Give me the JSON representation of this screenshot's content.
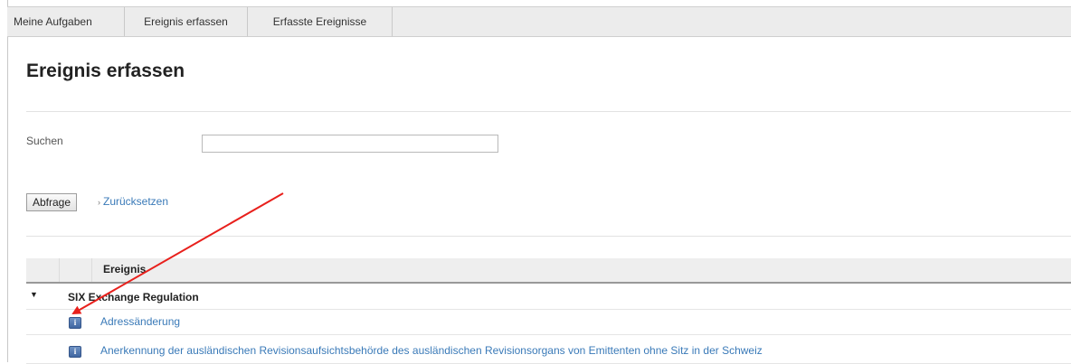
{
  "tabs": [
    {
      "label": "Meine Aufgaben"
    },
    {
      "label": "Ereignis erfassen"
    },
    {
      "label": "Erfasste Ereignisse"
    }
  ],
  "page": {
    "title": "Ereignis erfassen"
  },
  "search": {
    "label": "Suchen",
    "value": ""
  },
  "actions": {
    "query_label": "Abfrage",
    "reset_label": "Zurücksetzen"
  },
  "table": {
    "header": {
      "event": "Ereignis"
    },
    "group": {
      "label": "SIX Exchange Regulation",
      "toggle": "▼"
    },
    "items": [
      {
        "label": "Adressänderung",
        "icon": "info-icon"
      },
      {
        "label": "Anerkennung der ausländischen Revisionsaufsichtsbehörde des ausländischen Revisionsorgans von Emittenten ohne Sitz in der Schweiz",
        "icon": "info-icon"
      }
    ]
  },
  "colors": {
    "link": "#3a7ab8",
    "annotation_arrow": "#e8201c",
    "icon": "#4a6fa8"
  }
}
